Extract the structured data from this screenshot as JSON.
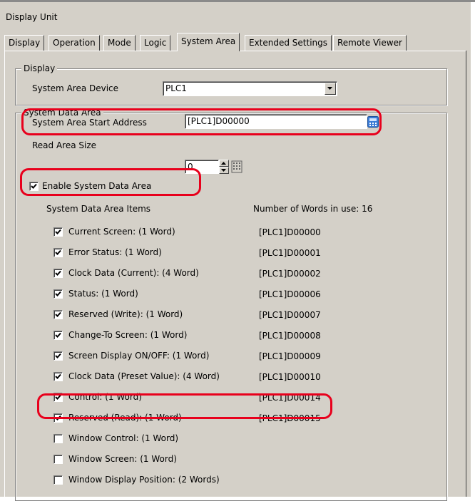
{
  "window": {
    "title": "Display Unit"
  },
  "tabs": [
    "Display",
    "Operation",
    "Mode",
    "Logic",
    "System Area",
    "Extended Settings",
    "Remote Viewer"
  ],
  "active_tab": "System Area",
  "display_group": {
    "title": "Display",
    "device_label": "System Area Device",
    "device_value": "PLC1"
  },
  "system_data_area": {
    "title": "System Data Area",
    "start_address_label": "System Area Start Address",
    "start_address_value": "[PLC1]D00000",
    "read_area_size_label": "Read Area Size",
    "read_area_size_value": "0",
    "enable_label": "Enable System Data Area",
    "enable_checked": true,
    "items_header": "System Data Area Items",
    "words_in_use": "Number of Words in use: 16",
    "items": [
      {
        "label": "Current Screen: (1 Word)",
        "checked": true,
        "address": "[PLC1]D00000"
      },
      {
        "label": "Error Status: (1 Word)",
        "checked": true,
        "address": "[PLC1]D00001"
      },
      {
        "label": "Clock Data (Current): (4 Word)",
        "checked": true,
        "address": "[PLC1]D00002"
      },
      {
        "label": "Status: (1 Word)",
        "checked": true,
        "address": "[PLC1]D00006"
      },
      {
        "label": "Reserved (Write): (1 Word)",
        "checked": true,
        "address": "[PLC1]D00007"
      },
      {
        "label": "Change-To Screen: (1 Word)",
        "checked": true,
        "address": "[PLC1]D00008"
      },
      {
        "label": "Screen Display ON/OFF: (1 Word)",
        "checked": true,
        "address": "[PLC1]D00009"
      },
      {
        "label": "Clock Data (Preset Value): (4 Word)",
        "checked": true,
        "address": "[PLC1]D00010"
      },
      {
        "label": "Control: (1 Word)",
        "checked": true,
        "address": "[PLC1]D00014"
      },
      {
        "label": "Reserved (Read): (1 Word)",
        "checked": true,
        "address": "[PLC1]D00015"
      },
      {
        "label": "Window Control: (1 Word)",
        "checked": false,
        "address": ""
      },
      {
        "label": "Window Screen: (1 Word)",
        "checked": false,
        "address": ""
      },
      {
        "label": "Window Display Position: (2 Words)",
        "checked": false,
        "address": ""
      }
    ]
  },
  "colors": {
    "highlight": "#e8001c",
    "dialog_bg": "#d4d0c8"
  },
  "icons": [
    "dropdown-arrow-icon",
    "address-picker-icon",
    "spin-up-icon",
    "spin-down-icon",
    "keypad-icon",
    "checkmark-icon"
  ]
}
